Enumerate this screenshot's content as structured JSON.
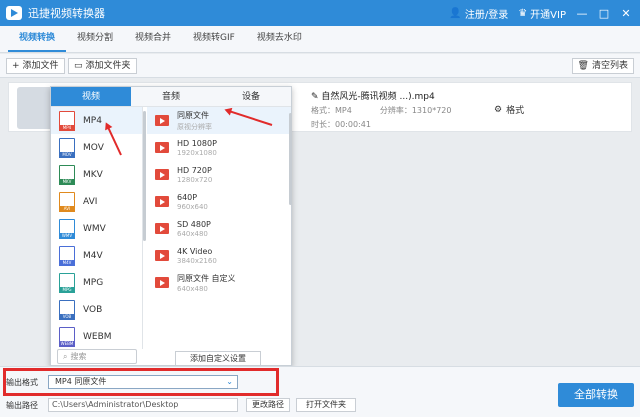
{
  "app": {
    "title": "迅捷视频转换器"
  },
  "titlebar": {
    "login": "注册/登录",
    "vip": "开通VIP",
    "min": "—",
    "max": "□",
    "close": "✕"
  },
  "tabs": [
    "视频转换",
    "视频分割",
    "视频合并",
    "视频转GIF",
    "视频去水印"
  ],
  "toolbar": {
    "add_file": "添加文件",
    "add_folder": "添加文件夹",
    "clear_list": "清空列表"
  },
  "file": {
    "name": "自然风光-腾讯视频 ...).mp4",
    "format_label": "格式：",
    "format": "MP4",
    "resolution_label": "分辨率：",
    "resolution": "1310*720",
    "duration_label": "时长：",
    "duration": "00:00:41",
    "settings": "格式"
  },
  "popup": {
    "tabs": [
      "视频",
      "音频",
      "设备"
    ],
    "formats": [
      {
        "name": "MP4",
        "color": "#e24a3b"
      },
      {
        "name": "MOV",
        "color": "#3a6fbf"
      },
      {
        "name": "MKV",
        "color": "#2e8b57"
      },
      {
        "name": "AVI",
        "color": "#e08a1e"
      },
      {
        "name": "WMV",
        "color": "#2f8bd8"
      },
      {
        "name": "M4V",
        "color": "#4a6fd8"
      },
      {
        "name": "MPG",
        "color": "#2aa198"
      },
      {
        "name": "VOB",
        "color": "#3a6fbf"
      },
      {
        "name": "WEBM",
        "color": "#5b5fc7"
      }
    ],
    "resolutions": [
      {
        "name": "同原文件",
        "sub": "原视分辨率"
      },
      {
        "name": "HD 1080P",
        "sub": "1920x1080"
      },
      {
        "name": "HD 720P",
        "sub": "1280x720"
      },
      {
        "name": "640P",
        "sub": "960x640"
      },
      {
        "name": "SD 480P",
        "sub": "640x480"
      },
      {
        "name": "4K Video",
        "sub": "3840x2160"
      },
      {
        "name": "同原文件 自定义",
        "sub": "640x480"
      }
    ],
    "search_placeholder": "搜索",
    "custom_button": "添加自定义设置"
  },
  "bottom": {
    "output_format_label": "输出格式",
    "output_format_value": "MP4  同原文件",
    "output_path_label": "输出路径",
    "output_path_value": "C:\\Users\\Administrator\\Desktop",
    "change_path": "更改路径",
    "open_folder": "打开文件夹",
    "convert_all": "全部转换"
  },
  "colors": {
    "accent": "#2f8bd8",
    "highlight": "#e12b2b"
  }
}
